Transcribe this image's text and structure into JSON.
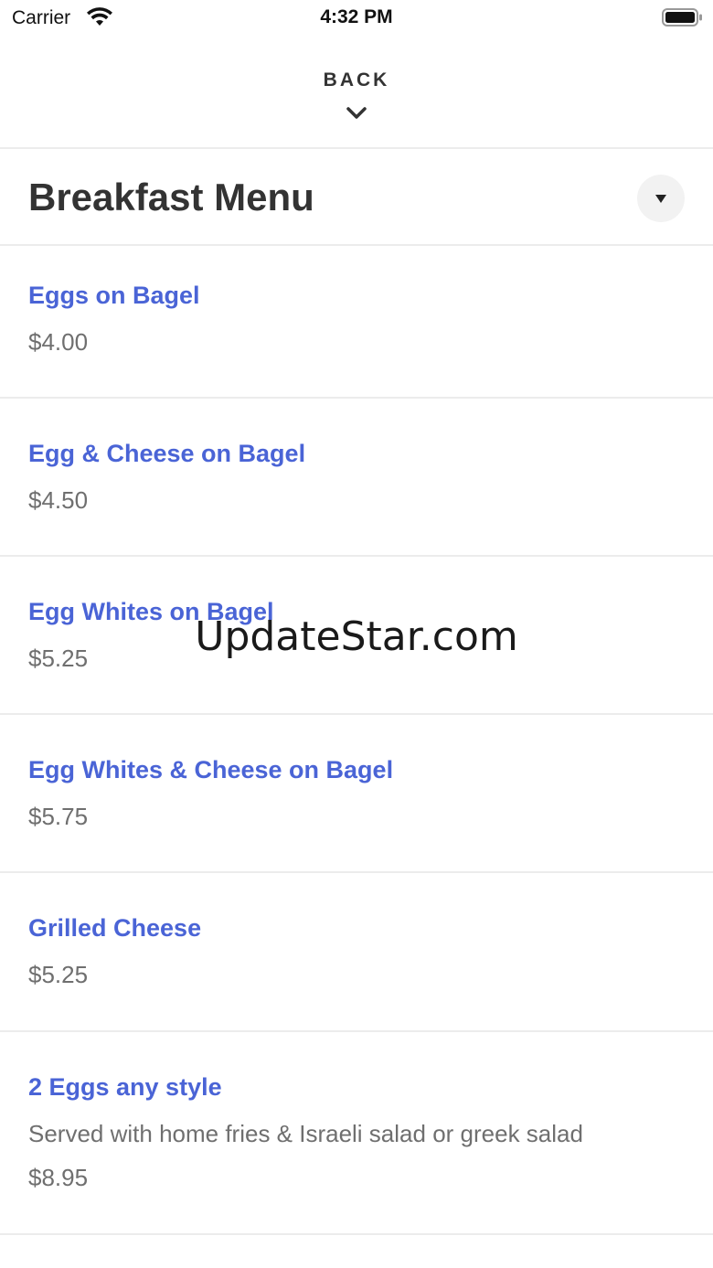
{
  "status_bar": {
    "carrier": "Carrier",
    "time": "4:32 PM"
  },
  "header": {
    "back_label": "BACK"
  },
  "menu": {
    "title": "Breakfast Menu",
    "items": [
      {
        "name": "Eggs on Bagel",
        "description": "",
        "price": "$4.00"
      },
      {
        "name": "Egg & Cheese on Bagel",
        "description": "",
        "price": "$4.50"
      },
      {
        "name": "Egg Whites on Bagel",
        "description": "",
        "price": "$5.25"
      },
      {
        "name": "Egg Whites & Cheese on Bagel",
        "description": "",
        "price": "$5.75"
      },
      {
        "name": "Grilled Cheese",
        "description": "",
        "price": "$5.25"
      },
      {
        "name": "2 Eggs any style",
        "description": "Served with home fries & Israeli salad or greek salad",
        "price": "$8.95"
      }
    ]
  },
  "watermark": "UpdateStar.com",
  "colors": {
    "item_name": "#4a64d6",
    "price_text": "#6f6f6f",
    "divider": "#ececec"
  },
  "icons": {
    "wifi": "wifi-icon",
    "battery": "battery-icon",
    "back": "chevron-down-icon",
    "dropdown": "caret-down-icon"
  }
}
